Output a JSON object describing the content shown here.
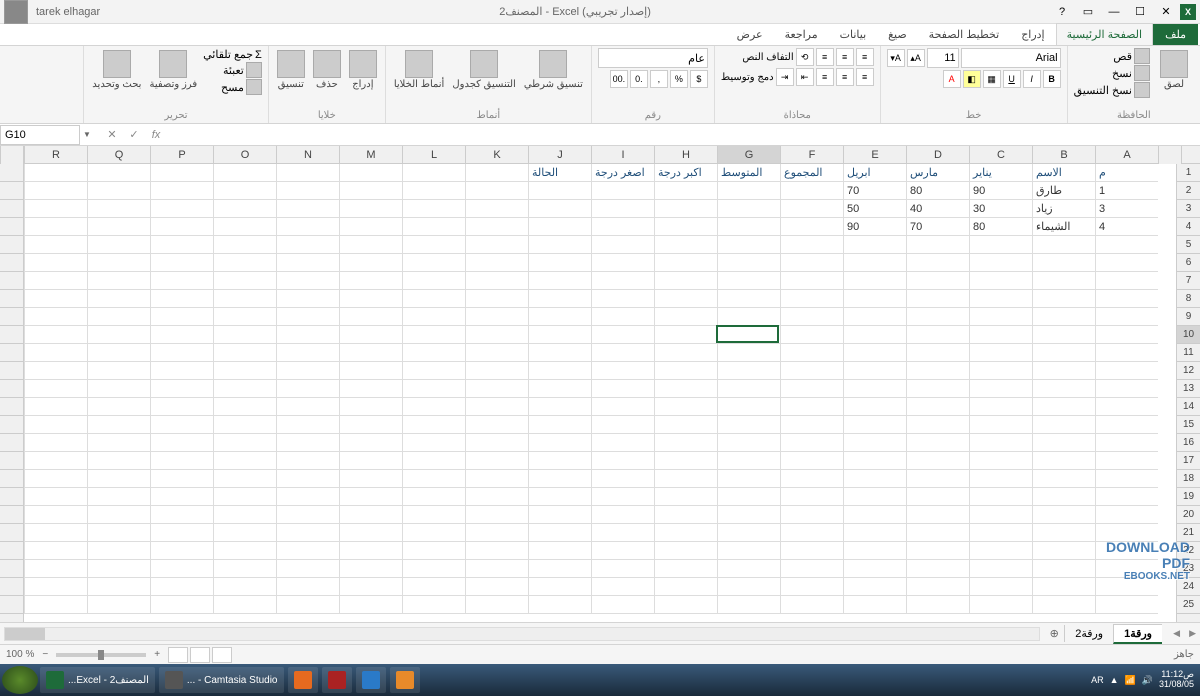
{
  "titlebar": {
    "app_title": "المصنف2 - Excel (إصدار تجريبي)",
    "username": "tarek elhagar"
  },
  "tabs": {
    "file": "ملف",
    "home": "الصفحة الرئيسية",
    "insert": "إدراج",
    "page_layout": "تخطيط الصفحة",
    "formulas": "صيغ",
    "data": "بيانات",
    "review": "مراجعة",
    "view": "عرض"
  },
  "ribbon": {
    "clipboard": {
      "label": "الحافظة",
      "paste": "لصق",
      "cut": "قص",
      "copy": "نسخ",
      "format_painter": "نسخ التنسيق"
    },
    "font": {
      "label": "خط",
      "font_name": "Arial",
      "font_size": "11"
    },
    "alignment": {
      "label": "محاذاة",
      "wrap_text": "التفاف النص",
      "merge": "دمج وتوسيط"
    },
    "number": {
      "label": "رقم",
      "format": "عام"
    },
    "styles": {
      "label": "أنماط",
      "conditional": "تنسيق شرطي",
      "table": "التنسيق كجدول",
      "cell_styles": "أنماط الخلايا"
    },
    "cells": {
      "label": "خلايا",
      "insert": "إدراج",
      "delete": "حذف",
      "format": "تنسيق"
    },
    "editing": {
      "label": "تحرير",
      "autosum": "جمع تلقائي",
      "fill": "تعبئة",
      "clear": "مسح",
      "sort_filter": "فرز وتصفية",
      "find_select": "بحث وتحديد"
    }
  },
  "formula_bar": {
    "name_box": "G10",
    "formula": ""
  },
  "columns_ltr": [
    "R",
    "Q",
    "P",
    "O",
    "N",
    "M",
    "L",
    "K",
    "J",
    "I",
    "H",
    "G",
    "F",
    "E",
    "D",
    "C",
    "B",
    "A"
  ],
  "rows": [
    "1",
    "2",
    "3",
    "4",
    "5",
    "6",
    "7",
    "8",
    "9",
    "10",
    "11",
    "12",
    "13",
    "14",
    "15",
    "16",
    "17",
    "18",
    "19",
    "20",
    "21",
    "22",
    "23",
    "24",
    "25"
  ],
  "selected_cell": {
    "col": "G",
    "row": 10
  },
  "cells": {
    "A1": "م",
    "B1": "الاسم",
    "C1": "يناير",
    "D1": "مارس",
    "E1": "ابريل",
    "F1": "المجموع",
    "G1": "المتوسط",
    "H1": "اكبر درجة",
    "I1": "اصغر درجة",
    "J1": "الحالة",
    "A2": "1",
    "B2": "طارق",
    "C2": "90",
    "D2": "80",
    "E2": "70",
    "A3": "3",
    "B3": "زياد",
    "C3": "30",
    "D3": "40",
    "E3": "50",
    "A4": "4",
    "B4": "الشيماء",
    "C4": "80",
    "D4": "70",
    "E4": "90"
  },
  "sheets": {
    "sheet1": "ورقة1",
    "sheet2": "ورقة2"
  },
  "status": {
    "ready": "جاهز",
    "zoom": "100 %"
  },
  "taskbar": {
    "excel": "...Excel - المصنف2",
    "camtasia": "... - Camtasia Studio",
    "lang": "AR",
    "time": "11:12ص",
    "date": "31/08/05"
  },
  "watermark": {
    "l1": "DOWNLOAD",
    "l2": "PDF",
    "l3": "EBOOKS.NET"
  }
}
